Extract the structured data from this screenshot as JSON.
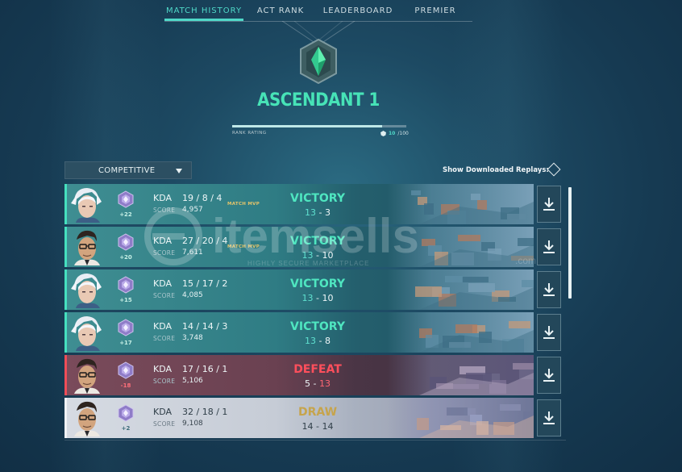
{
  "tabs": [
    {
      "label": "MATCH HISTORY",
      "active": true
    },
    {
      "label": "ACT RANK",
      "active": false
    },
    {
      "label": "LEADERBOARD",
      "active": false
    },
    {
      "label": "PREMIER",
      "active": false
    }
  ],
  "rank": {
    "name": "ASCENDANT 1",
    "rating_label": "RANK RATING",
    "rating_current": "10",
    "rating_max": "/100",
    "rating_fraction": 0.1,
    "accent_color": "#47e3b7"
  },
  "queue": {
    "selected": "COMPETITIVE",
    "icon": "chevron-down-icon"
  },
  "replays": {
    "label": "Show Downloaded Replays:",
    "icon": "diamond-toggle-icon"
  },
  "matches": [
    {
      "outcome": "victory",
      "agent": "jett",
      "rr_change": "+22",
      "kda_label": "KDA",
      "kda": "19 / 8 / 4",
      "score_label": "SCORE",
      "score": "4,957",
      "mvp": "MATCH MVP",
      "result": "VICTORY",
      "team_score": "13",
      "dash": "-",
      "enemy_score": "3"
    },
    {
      "outcome": "victory",
      "agent": "chamber",
      "rr_change": "+20",
      "kda_label": "KDA",
      "kda": "27 / 20 / 4",
      "score_label": "SCORE",
      "score": "7,611",
      "mvp": "MATCH MVP",
      "result": "VICTORY",
      "team_score": "13",
      "dash": "-",
      "enemy_score": "10"
    },
    {
      "outcome": "victory",
      "agent": "jett",
      "rr_change": "+15",
      "kda_label": "KDA",
      "kda": "15 / 17 / 2",
      "score_label": "SCORE",
      "score": "4,085",
      "mvp": "",
      "result": "VICTORY",
      "team_score": "13",
      "dash": "-",
      "enemy_score": "10"
    },
    {
      "outcome": "victory",
      "agent": "jett",
      "rr_change": "+17",
      "kda_label": "KDA",
      "kda": "14 / 14 / 3",
      "score_label": "SCORE",
      "score": "3,748",
      "mvp": "",
      "result": "VICTORY",
      "team_score": "13",
      "dash": "-",
      "enemy_score": "8"
    },
    {
      "outcome": "defeat",
      "agent": "chamber",
      "rr_change": "-18",
      "kda_label": "KDA",
      "kda": "17 / 16 / 1",
      "score_label": "SCORE",
      "score": "5,106",
      "mvp": "",
      "result": "DEFEAT",
      "team_score": "5",
      "dash": "-",
      "enemy_score": "13"
    },
    {
      "outcome": "draw",
      "agent": "chamber",
      "rr_change": "+2",
      "kda_label": "KDA",
      "kda": "32 / 18 / 1",
      "score_label": "SCORE",
      "score": "9,108",
      "mvp": "",
      "result": "DRAW",
      "team_score": "14",
      "dash": "-",
      "enemy_score": "14"
    }
  ],
  "watermark": {
    "text": "itemsells",
    "subtext": "HIGHLY SECURE MARKETPLACE",
    "domain": ".com"
  },
  "colors": {
    "victory": "#45e0bf",
    "defeat": "#ee4d58",
    "draw": "#c6a44c",
    "background": "#1d4a63"
  }
}
